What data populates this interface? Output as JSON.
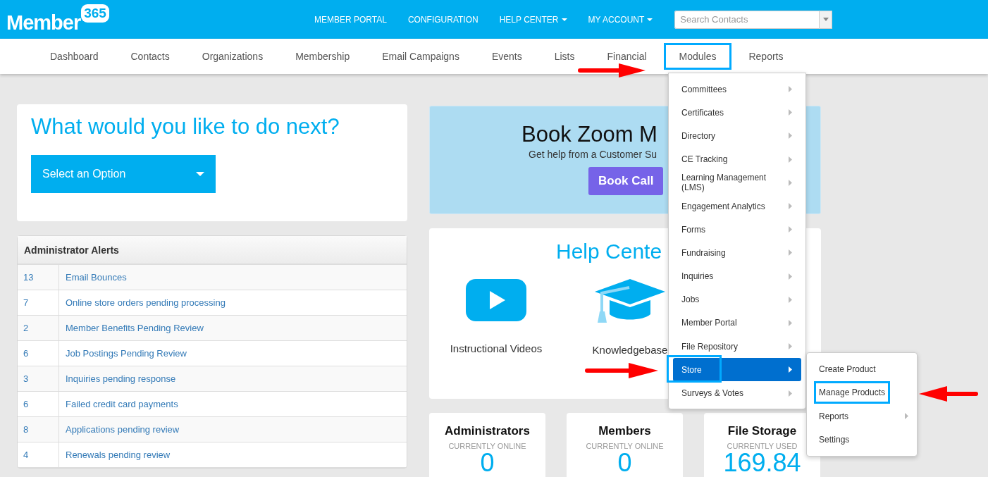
{
  "header": {
    "logo_text": "Member",
    "logo_badge": "365",
    "links": [
      {
        "label": "MEMBER PORTAL",
        "dropdown": false
      },
      {
        "label": "CONFIGURATION",
        "dropdown": false
      },
      {
        "label": "HELP CENTER",
        "dropdown": true
      },
      {
        "label": "MY ACCOUNT",
        "dropdown": true
      }
    ],
    "search": {
      "placeholder": "Search Contacts"
    }
  },
  "nav": [
    {
      "label": "Dashboard",
      "highlighted": false
    },
    {
      "label": "Contacts",
      "highlighted": false
    },
    {
      "label": "Organizations",
      "highlighted": false
    },
    {
      "label": "Membership",
      "highlighted": false
    },
    {
      "label": "Email Campaigns",
      "highlighted": false
    },
    {
      "label": "Events",
      "highlighted": false
    },
    {
      "label": "Lists",
      "highlighted": false
    },
    {
      "label": "Financial",
      "highlighted": false
    },
    {
      "label": "Modules",
      "highlighted": true
    },
    {
      "label": "Reports",
      "highlighted": false
    }
  ],
  "next_card": {
    "title": "What would you like to do next?",
    "select": "Select an Option"
  },
  "alerts": {
    "title": "Administrator Alerts",
    "rows": [
      {
        "count": "13",
        "text": "Email Bounces"
      },
      {
        "count": "7",
        "text": "Online store orders pending processing"
      },
      {
        "count": "2",
        "text": "Member Benefits Pending Review"
      },
      {
        "count": "6",
        "text": "Job Postings Pending Review"
      },
      {
        "count": "3",
        "text": "Inquiries pending response"
      },
      {
        "count": "6",
        "text": "Failed credit card payments"
      },
      {
        "count": "8",
        "text": "Applications pending review"
      },
      {
        "count": "4",
        "text": "Renewals pending review"
      }
    ]
  },
  "zoom_banner": {
    "title": "Book Zoom M",
    "subtitle": "Get help from a Customer Su",
    "button": "Book Call"
  },
  "help_center": {
    "title": "Help Cente",
    "items": [
      {
        "kind": "video",
        "label": "Instructional Videos"
      },
      {
        "kind": "knowledge",
        "label": "Knowledgebase"
      }
    ]
  },
  "stats": [
    {
      "title": "Administrators",
      "caption": "CURRENTLY ONLINE",
      "value": "0"
    },
    {
      "title": "Members",
      "caption": "CURRENTLY ONLINE",
      "value": "0"
    },
    {
      "title": "File Storage",
      "caption": "CURRENTLY USED",
      "value": "169.84"
    }
  ],
  "modules_menu": [
    {
      "label": "Committees",
      "submenu": true,
      "selected": false,
      "highlighted": false
    },
    {
      "label": "Certificates",
      "submenu": true,
      "selected": false,
      "highlighted": false
    },
    {
      "label": "Directory",
      "submenu": true,
      "selected": false,
      "highlighted": false
    },
    {
      "label": "CE Tracking",
      "submenu": true,
      "selected": false,
      "highlighted": false
    },
    {
      "label": "Learning Management (LMS)",
      "submenu": true,
      "selected": false,
      "highlighted": false
    },
    {
      "label": "Engagement Analytics",
      "submenu": true,
      "selected": false,
      "highlighted": false
    },
    {
      "label": "Forms",
      "submenu": true,
      "selected": false,
      "highlighted": false
    },
    {
      "label": "Fundraising",
      "submenu": true,
      "selected": false,
      "highlighted": false
    },
    {
      "label": "Inquiries",
      "submenu": true,
      "selected": false,
      "highlighted": false
    },
    {
      "label": "Jobs",
      "submenu": true,
      "selected": false,
      "highlighted": false
    },
    {
      "label": "Member Portal",
      "submenu": true,
      "selected": false,
      "highlighted": false
    },
    {
      "label": "File Repository",
      "submenu": true,
      "selected": false,
      "highlighted": false
    },
    {
      "label": "Store",
      "submenu": true,
      "selected": true,
      "highlighted": true
    },
    {
      "label": "Surveys & Votes",
      "submenu": true,
      "selected": false,
      "highlighted": false
    }
  ],
  "store_submenu": [
    {
      "label": "Create Product",
      "submenu": false,
      "highlighted": false
    },
    {
      "label": "Manage Products",
      "submenu": false,
      "highlighted": true
    },
    {
      "label": "Reports",
      "submenu": true,
      "highlighted": false
    },
    {
      "label": "Settings",
      "submenu": false,
      "highlighted": false
    }
  ]
}
